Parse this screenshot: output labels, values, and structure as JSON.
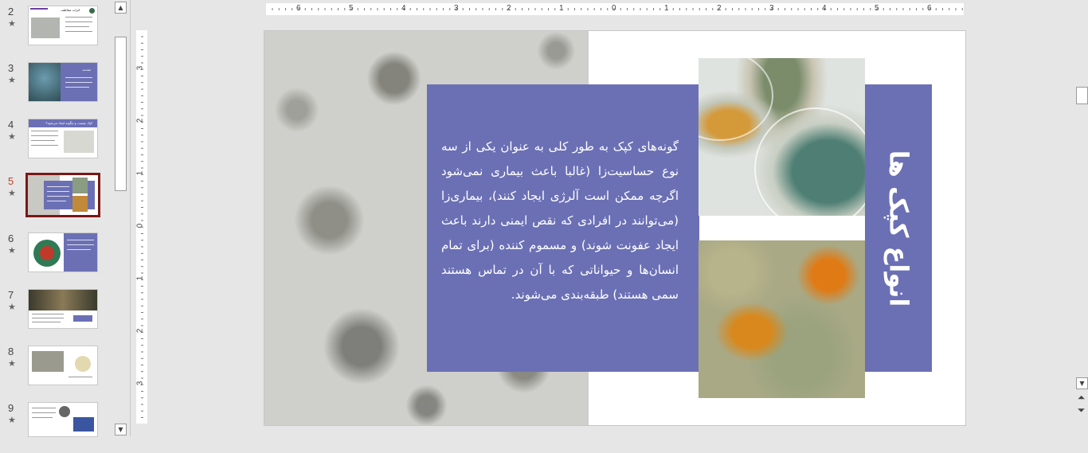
{
  "thumbnails": [
    {
      "num": "2",
      "star": "★",
      "title": "اثرات مخاطب",
      "active": false
    },
    {
      "num": "3",
      "star": "★",
      "title": "مقدمه",
      "active": false
    },
    {
      "num": "4",
      "star": "★",
      "title": "کپک چیست و چگونه ایجاد می‌شود؟",
      "active": false
    },
    {
      "num": "5",
      "star": "★",
      "title": "انواع کپک ها",
      "active": true
    },
    {
      "num": "6",
      "star": "★",
      "title": "",
      "active": false
    },
    {
      "num": "7",
      "star": "★",
      "title": "",
      "active": false
    },
    {
      "num": "8",
      "star": "★",
      "title": "",
      "active": false
    },
    {
      "num": "9",
      "star": "★",
      "title": "",
      "active": false
    }
  ],
  "h_ruler_labels": [
    "6",
    "5",
    "4",
    "3",
    "2",
    "1",
    "0",
    "1",
    "2",
    "3",
    "4",
    "5",
    "6"
  ],
  "v_ruler_labels": [
    "3",
    "2",
    "1",
    "0",
    "1",
    "2",
    "3"
  ],
  "slide": {
    "title": "انواع کپک ها",
    "body": "گونه‌های کپک به طور کلی به عنوان یکی از سه نوع حساسیت‌زا (غالبا باعث بیماری نمی‌شود اگرچه ممکن است آلرژی ایجاد کنند)، بیماری‌زا (می‌توانند در افرادی که نقص ایمنی دارند باعث ایجاد عفونت شوند) و مسموم کننده (برای تمام انسان‌ها و حیواناتی که با آن در تماس هستند سمی هستند) طبقه‌بندی می‌شوند."
  },
  "colors": {
    "accent": "#6b70b5",
    "active_thumb_border": "#7a1717",
    "active_num": "#c5401f"
  },
  "icons": {
    "scroll_up": "▲",
    "scroll_down": "▼",
    "prev_slide": "⏶",
    "next_slide": "⏷"
  }
}
